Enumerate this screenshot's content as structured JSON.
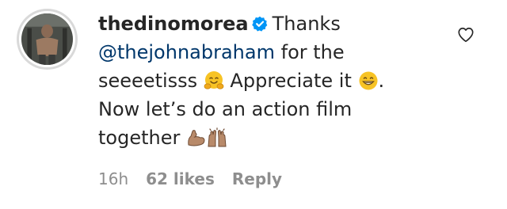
{
  "comment": {
    "username": "thedinomorea",
    "verified_icon": "verified-badge-icon",
    "text_part1": "Thanks ",
    "mention": "@thejohnabraham",
    "text_part2": " for the seeeetisss ",
    "emoji1": "hugging-face-emoji",
    "text_part3": " Appreciate it ",
    "emoji2": "grinning-face-emoji",
    "text_part4": ". Now let’s do an action film together ",
    "emoji3": "flexed-biceps-emoji",
    "emoji4": "raising-hands-emoji"
  },
  "meta": {
    "time": "16h",
    "likes": "62 likes",
    "reply": "Reply"
  },
  "icons": {
    "like": "heart-outline-icon",
    "avatar": "profile-avatar"
  },
  "colors": {
    "text": "#262626",
    "mention": "#00376b",
    "meta": "#8e8e8e",
    "verified": "#0095f6"
  }
}
